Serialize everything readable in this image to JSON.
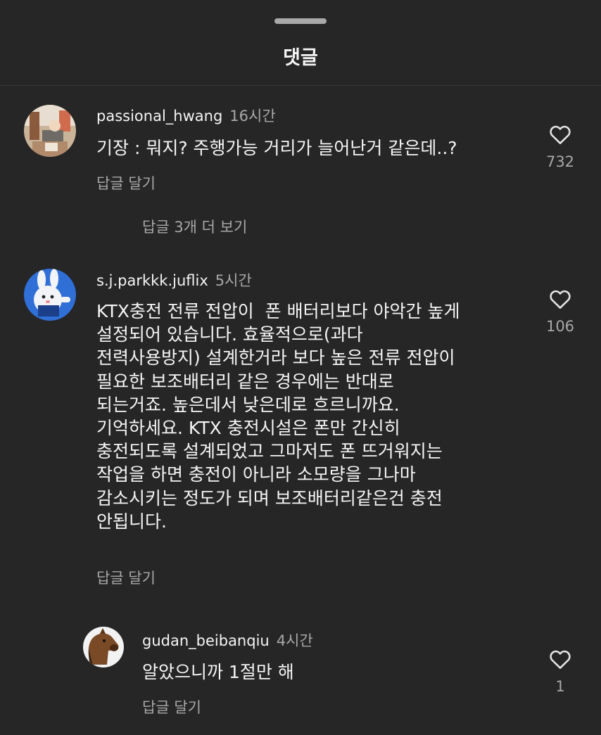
{
  "header": {
    "title": "댓글"
  },
  "comments": [
    {
      "username": "passional_hwang",
      "time": "16시간",
      "text": "기장 : 뭐지? 주행가능 거리가 늘어난거 같은데..?",
      "reply_label": "답글 달기",
      "likes": "732",
      "view_replies": "답글 3개 더 보기"
    },
    {
      "username": "s.j.parkkk.juflix",
      "time": "5시간",
      "text": "KTX충전 전류 전압이  폰 배터리보다 야악간 높게\n설정되어 있습니다. 효율적으로(과다\n전력사용방지) 설계한거라 보다 높은 전류 전압이\n필요한 보조배터리 같은 경우에는 반대로\n되는거죠. 높은데서 낮은데로 흐르니까요.\n기억하세요. KTX 충전시설은 폰만 간신히\n충전되도록 설계되었고 그마저도 폰 뜨거워지는\n작업을 하면 충전이 아니라 소모량을 그나마\n감소시키는 정도가 되며 보조배터리같은건 충전\n안됩니다.",
      "reply_label": "답글 달기",
      "likes": "106"
    },
    {
      "username": "gudan_beibanqiu",
      "time": "4시간",
      "text": "알았으니까 1절만 해",
      "reply_label": "답글 달기",
      "likes": "1"
    }
  ]
}
